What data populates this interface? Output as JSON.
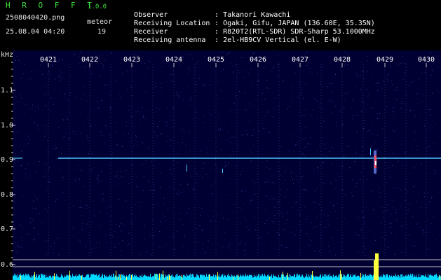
{
  "header": {
    "brand": "H R O F F T",
    "version": "1.0.0",
    "filename": "2508040420.png",
    "meteor_label": "meteor",
    "datetime": "25.08.04 04:20",
    "meteor_count": "19"
  },
  "info": [
    {
      "label": "Observer",
      "value": ": Takanori Kawachi"
    },
    {
      "label": "Receiving Location",
      "value": ": Ogaki, Gifu, JAPAN (136.60E, 35.35N)"
    },
    {
      "label": "Receiver",
      "value": ": R820T2(RTL-SDR) SDR-Sharp 53.1000MHz"
    },
    {
      "label": "Receiving antenna",
      "value": ": 2el-HB9CV Vertical (el. E-W)"
    }
  ],
  "plot": {
    "y_unit": "kHz",
    "y_ticks": [
      "1.1",
      "1.0",
      "0.9",
      "0.8",
      "0.7",
      "0.6"
    ],
    "x_ticks": [
      "0421",
      "0422",
      "0423",
      "0424",
      "0425",
      "0426",
      "0427",
      "0428",
      "0429",
      "0430"
    ],
    "colors": {
      "background": "#000033",
      "carrier": "#49c8ff",
      "meteor": "#ff5060",
      "baseline": "#00e0ff",
      "spike": "#ffff40"
    }
  }
}
